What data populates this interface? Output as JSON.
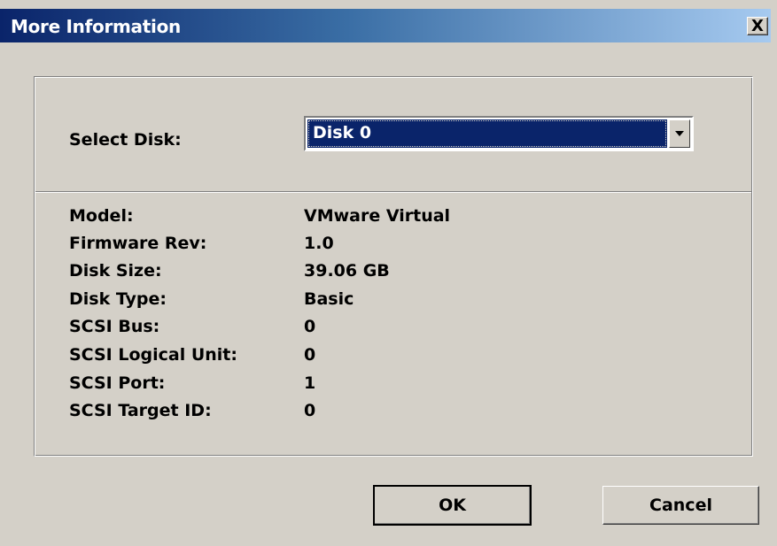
{
  "window": {
    "title": "More Information",
    "close_label": "X"
  },
  "select_disk": {
    "label": "Select Disk:",
    "selected": "Disk 0"
  },
  "info": [
    {
      "label": "Model:",
      "value": "VMware  Virtual"
    },
    {
      "label": "Firmware Rev:",
      "value": "1.0"
    },
    {
      "label": "Disk Size:",
      "value": "39.06 GB"
    },
    {
      "label": "Disk Type:",
      "value": "Basic"
    },
    {
      "label": "SCSI Bus:",
      "value": "0"
    },
    {
      "label": "SCSI Logical Unit:",
      "value": "0"
    },
    {
      "label": "SCSI Port:",
      "value": "1"
    },
    {
      "label": "SCSI Target ID:",
      "value": "0"
    }
  ],
  "buttons": {
    "ok": "OK",
    "cancel": "Cancel"
  },
  "colors": {
    "title_bar_start": "#0a246a",
    "title_bar_end": "#a6caf0",
    "dialog_background": "#d4d0c8",
    "selection_highlight": "#0a246a"
  }
}
